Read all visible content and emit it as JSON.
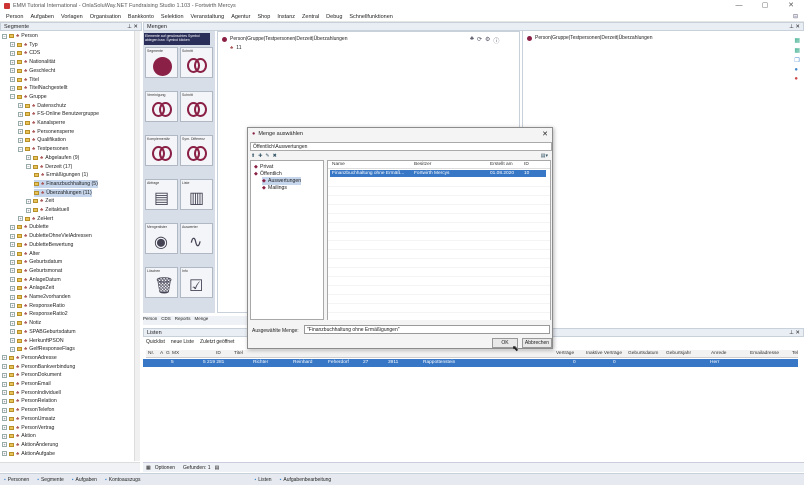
{
  "window": {
    "title": "EMM Tutorial International - OnlaSoluWay.NET Fundraising Studio 1.103 - Fortwirth Mercys",
    "minimize": "—",
    "maximize": "▢",
    "close": "✕"
  },
  "menu": [
    "Person",
    "Aufgaben",
    "Vorlagen",
    "Organisation",
    "Bankkonto",
    "Selektion",
    "Veranstaltung",
    "Agentur",
    "Shop",
    "Instanz",
    "Zentral",
    "Debug",
    "Schnellfunktionen"
  ],
  "segments": {
    "title": "Segmente",
    "pin": "⊥ ✕",
    "nodes": [
      {
        "label": "Person",
        "depth": 0,
        "exp": "−"
      },
      {
        "label": "Typ",
        "depth": 1,
        "exp": "+"
      },
      {
        "label": "CDS",
        "depth": 1,
        "exp": "+"
      },
      {
        "label": "Nationalität",
        "depth": 1,
        "exp": "+"
      },
      {
        "label": "Geschlecht",
        "depth": 1,
        "exp": "+"
      },
      {
        "label": "Titel",
        "depth": 1,
        "exp": "+"
      },
      {
        "label": "TitelNachgestellt",
        "depth": 1,
        "exp": "+"
      },
      {
        "label": "Gruppe",
        "depth": 1,
        "exp": "−"
      },
      {
        "label": "Datenschutz",
        "depth": 2,
        "exp": "+"
      },
      {
        "label": "FS-Online Benutzergruppe",
        "depth": 2,
        "exp": "+"
      },
      {
        "label": "Kanalsperre",
        "depth": 2,
        "exp": "+"
      },
      {
        "label": "Personensperre",
        "depth": 2,
        "exp": "+"
      },
      {
        "label": "Qualifikation",
        "depth": 2,
        "exp": "+"
      },
      {
        "label": "Testpersonen",
        "depth": 2,
        "exp": "−"
      },
      {
        "label": "Abgelaufen (9)",
        "depth": 3,
        "exp": "+"
      },
      {
        "label": "Derzeit (17)",
        "depth": 3,
        "exp": "−"
      },
      {
        "label": "Ermäßigungen (1)",
        "depth": 4,
        "exp": ""
      },
      {
        "label": "Finanzbuchhaltung (5)",
        "depth": 4,
        "exp": "",
        "sel": true
      },
      {
        "label": "Überzahlungen (11)",
        "depth": 4,
        "exp": "",
        "sel": true
      },
      {
        "label": "Zeit",
        "depth": 3,
        "exp": "+"
      },
      {
        "label": "Zeitaktuell",
        "depth": 3,
        "exp": "+"
      },
      {
        "label": "ZeHert",
        "depth": 2,
        "exp": "+"
      },
      {
        "label": "Dublette",
        "depth": 1,
        "exp": "+"
      },
      {
        "label": "DubletteOhneVielAdressen",
        "depth": 1,
        "exp": "+"
      },
      {
        "label": "DubletteBewertung",
        "depth": 1,
        "exp": "+"
      },
      {
        "label": "Alter",
        "depth": 1,
        "exp": "+"
      },
      {
        "label": "Geburtsdatum",
        "depth": 1,
        "exp": "+"
      },
      {
        "label": "Geburtsmonat",
        "depth": 1,
        "exp": "+"
      },
      {
        "label": "AnlageDatum",
        "depth": 1,
        "exp": "+"
      },
      {
        "label": "AnlageZeit",
        "depth": 1,
        "exp": "+"
      },
      {
        "label": "Name2vorhanden",
        "depth": 1,
        "exp": "+"
      },
      {
        "label": "ResponseRatio",
        "depth": 1,
        "exp": "+"
      },
      {
        "label": "ResponseRatio2",
        "depth": 1,
        "exp": "+"
      },
      {
        "label": "Notiz",
        "depth": 1,
        "exp": "+"
      },
      {
        "label": "SPABGeburtsdatum",
        "depth": 1,
        "exp": "+"
      },
      {
        "label": "HerkunftPSON",
        "depth": 1,
        "exp": "+"
      },
      {
        "label": "GelfResponseFlags",
        "depth": 1,
        "exp": "+"
      },
      {
        "label": "PersonAdresse",
        "depth": 0,
        "exp": "+"
      },
      {
        "label": "PersonBankverbindung",
        "depth": 0,
        "exp": "+"
      },
      {
        "label": "PersonDokument",
        "depth": 0,
        "exp": "+"
      },
      {
        "label": "PersonEmail",
        "depth": 0,
        "exp": "+"
      },
      {
        "label": "PersonIndividuell",
        "depth": 0,
        "exp": "+"
      },
      {
        "label": "PersonRelation",
        "depth": 0,
        "exp": "+"
      },
      {
        "label": "PersonTelefon",
        "depth": 0,
        "exp": "+"
      },
      {
        "label": "PersonUmsatz",
        "depth": 0,
        "exp": "+"
      },
      {
        "label": "PersonVertrag",
        "depth": 0,
        "exp": "+"
      },
      {
        "label": "Aktion",
        "depth": 0,
        "exp": "+"
      },
      {
        "label": "AktionÄnderung",
        "depth": 0,
        "exp": "+"
      },
      {
        "label": "AktionAufgabe",
        "depth": 0,
        "exp": "+"
      }
    ]
  },
  "mengen": {
    "title": "Mengen",
    "pin": "⊥ ✕",
    "hint": "Elemente auf gewünschtes Symbol ablegen bzw. Symbol klicken",
    "tiles": [
      "Segmente",
      "Schnitt",
      "Vereinigung",
      "Schnitt",
      "Komplementär",
      "Sym. Differenz",
      "Abfrage",
      "Liste",
      "Mengenlister",
      "Auswerter",
      "Löschen",
      "Info"
    ],
    "path1": "Person|Gruppe|Testpersonen|Derzeit|Überzahlungen",
    "count1": "11",
    "path2": "Person|Gruppe|Testpersonen|Derzeit|Überzahlungen",
    "tabs": [
      "Person",
      "CDS",
      "Reports",
      "Menge"
    ]
  },
  "dialog": {
    "title": "Menge auswählen",
    "path": "Öffentlich\\Auswertungen",
    "tree": [
      "Privat",
      "Öffentlich",
      "Auswertungen",
      "Mailings"
    ],
    "columns": [
      "Name",
      "Besitzer",
      "Erstellt am",
      "ID"
    ],
    "row": [
      "Finanzbuchhaltung ohne Ermäß...",
      "Fortwirth Mercys",
      "01.08.2020",
      "10"
    ],
    "selected_label": "Ausgewählte Menge:",
    "selected_value": "\"Finanzbuchhaltung ohne Ermäßigungen\"",
    "ok": "OK",
    "cancel": "Abbrechen"
  },
  "listen": {
    "title": "Listen",
    "pin": "⊥ ✕",
    "tools": [
      "Quicklist",
      "neue Liste",
      "Zuletzt geöffnet"
    ],
    "cols": [
      "Nr.",
      "A",
      "G",
      "MX",
      "ID",
      "Titel"
    ],
    "rcols": [
      "Verträge",
      "Inaktive Verträge",
      "Geburtsdatum",
      "Geburtsjahr",
      "Anrede",
      "Emailadresse",
      "Tel"
    ],
    "row": [
      "5",
      "5 219 281",
      "Richter",
      "Reinhard",
      "Feherdorf",
      "27",
      "3911",
      "Rappottenstein",
      "0",
      "0",
      "Herr"
    ],
    "footer_options": "Optionen",
    "footer_found": "Gefunden: 1"
  },
  "statusbar": [
    "Personen",
    "Segmente",
    "Aufgaben",
    "Kontoauszugs",
    "Listen",
    "Aufgabenbearbeitung"
  ]
}
